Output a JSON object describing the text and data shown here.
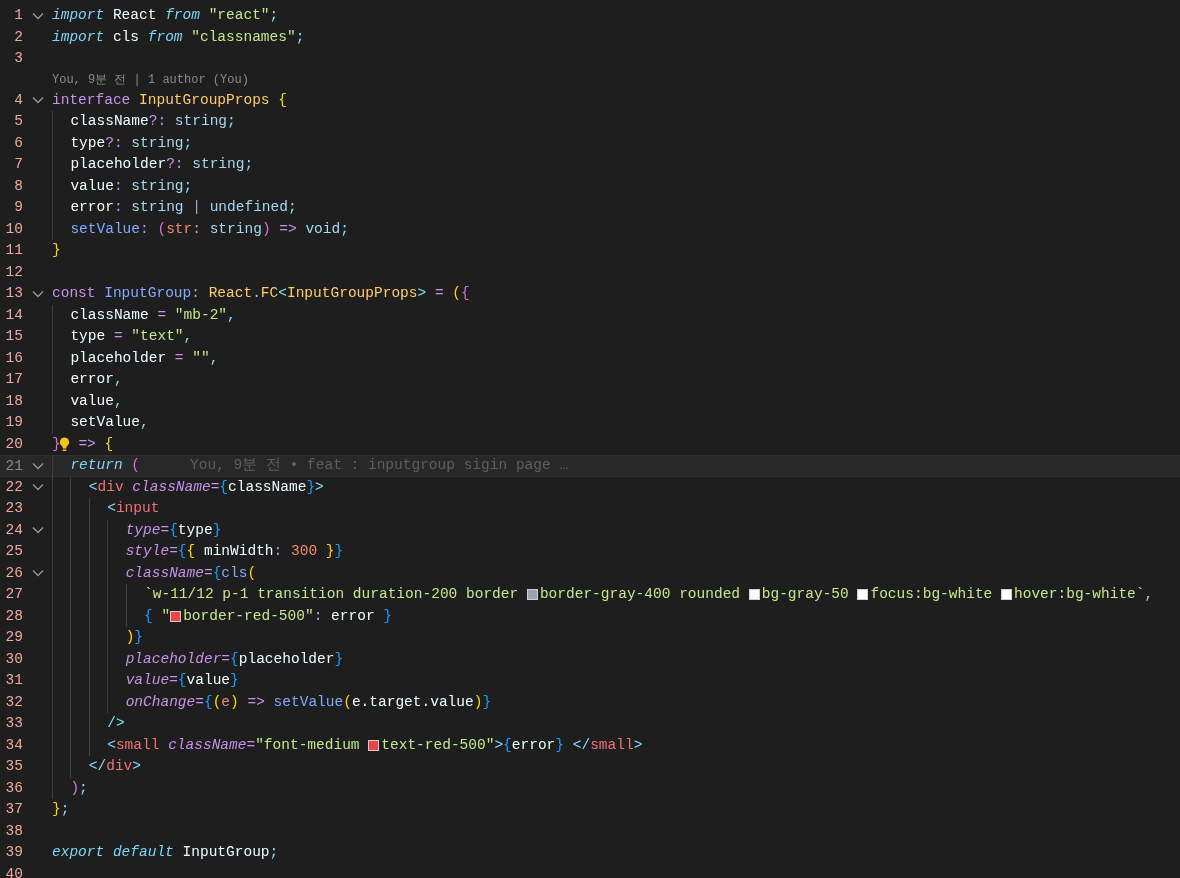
{
  "editor": {
    "lines": [
      {
        "kind": "code",
        "number": "1",
        "fold": true,
        "tokens": [
          {
            "text": "import",
            "kind": "kw"
          },
          {
            "text": " React ",
            "kind": "plain"
          },
          {
            "text": "from",
            "kind": "kw"
          },
          {
            "text": " \"react\"",
            "kind": "string"
          },
          {
            "text": ";",
            "kind": "punct"
          }
        ]
      },
      {
        "kind": "code",
        "number": "2",
        "fold": false,
        "tokens": [
          {
            "text": "import",
            "kind": "kw"
          },
          {
            "text": " cls ",
            "kind": "plain"
          },
          {
            "text": "from",
            "kind": "kw"
          },
          {
            "text": " \"classnames\"",
            "kind": "string"
          },
          {
            "text": ";",
            "kind": "punct"
          }
        ]
      },
      {
        "kind": "code",
        "number": "3",
        "fold": false
      },
      {
        "kind": "codelens",
        "text": "You, 9분 전 | 1 author (You)"
      },
      {
        "kind": "code",
        "number": "4",
        "fold": true,
        "tokens": [
          {
            "text": "interface",
            "kind": "storage"
          },
          {
            "text": " InputGroupProps",
            "kind": "typename"
          },
          {
            "text": " {",
            "kind": "b1"
          }
        ]
      },
      {
        "kind": "code",
        "number": "5",
        "fold": false,
        "tokens": [
          {
            "text": "  className",
            "kind": "plain"
          },
          {
            "text": "?:",
            "kind": "op"
          },
          {
            "text": " string",
            "kind": "builtin"
          },
          {
            "text": ";",
            "kind": "punct"
          }
        ]
      },
      {
        "kind": "code",
        "number": "6",
        "fold": false,
        "tokens": [
          {
            "text": "  type",
            "kind": "plain"
          },
          {
            "text": "?:",
            "kind": "op"
          },
          {
            "text": " string",
            "kind": "builtin"
          },
          {
            "text": ";",
            "kind": "punct"
          }
        ]
      },
      {
        "kind": "code",
        "number": "7",
        "fold": false,
        "tokens": [
          {
            "text": "  placeholder",
            "kind": "plain"
          },
          {
            "text": "?:",
            "kind": "op"
          },
          {
            "text": " string",
            "kind": "builtin"
          },
          {
            "text": ";",
            "kind": "punct"
          }
        ]
      },
      {
        "kind": "code",
        "number": "8",
        "fold": false,
        "tokens": [
          {
            "text": "  value",
            "kind": "plain"
          },
          {
            "text": ":",
            "kind": "op"
          },
          {
            "text": " string",
            "kind": "builtin"
          },
          {
            "text": ";",
            "kind": "punct"
          }
        ]
      },
      {
        "kind": "code",
        "number": "9",
        "fold": false,
        "tokens": [
          {
            "text": "  error",
            "kind": "plain"
          },
          {
            "text": ":",
            "kind": "op"
          },
          {
            "text": " string ",
            "kind": "builtin"
          },
          {
            "text": "|",
            "kind": "op"
          },
          {
            "text": " undefined",
            "kind": "builtin"
          },
          {
            "text": ";",
            "kind": "punct"
          }
        ]
      },
      {
        "kind": "code",
        "number": "10",
        "fold": false,
        "tokens": [
          {
            "text": "  setValue",
            "kind": "func"
          },
          {
            "text": ":",
            "kind": "op"
          },
          {
            "text": " (",
            "kind": "b2"
          },
          {
            "text": "str",
            "kind": "param"
          },
          {
            "text": ":",
            "kind": "op"
          },
          {
            "text": " string",
            "kind": "builtin"
          },
          {
            "text": ")",
            "kind": "b2"
          },
          {
            "text": " =>",
            "kind": "storage"
          },
          {
            "text": " void",
            "kind": "builtin"
          },
          {
            "text": ";",
            "kind": "punct"
          }
        ]
      },
      {
        "kind": "code",
        "number": "11",
        "fold": false,
        "tokens": [
          {
            "text": "}",
            "kind": "b1"
          }
        ]
      },
      {
        "kind": "code",
        "number": "12",
        "fold": false
      },
      {
        "kind": "code",
        "number": "13",
        "fold": true,
        "tokens": [
          {
            "text": "const",
            "kind": "storage"
          },
          {
            "text": " InputGroup",
            "kind": "func"
          },
          {
            "text": ":",
            "kind": "op"
          },
          {
            "text": " React",
            "kind": "typename"
          },
          {
            "text": ".",
            "kind": "punct"
          },
          {
            "text": "FC",
            "kind": "typename"
          },
          {
            "text": "<",
            "kind": "punct"
          },
          {
            "text": "InputGroupProps",
            "kind": "typename"
          },
          {
            "text": ">",
            "kind": "punct"
          },
          {
            "text": " = ",
            "kind": "op"
          },
          {
            "text": "(",
            "kind": "b1"
          },
          {
            "text": "{",
            "kind": "b2"
          }
        ]
      },
      {
        "kind": "code",
        "number": "14",
        "fold": false,
        "tokens": [
          {
            "text": "  className",
            "kind": "plain"
          },
          {
            "text": " = ",
            "kind": "op"
          },
          {
            "text": "\"mb-2\"",
            "kind": "string"
          },
          {
            "text": ",",
            "kind": "punct"
          }
        ]
      },
      {
        "kind": "code",
        "number": "15",
        "fold": false,
        "tokens": [
          {
            "text": "  type",
            "kind": "plain"
          },
          {
            "text": " = ",
            "kind": "op"
          },
          {
            "text": "\"text\"",
            "kind": "string"
          },
          {
            "text": ",",
            "kind": "punct"
          }
        ]
      },
      {
        "kind": "code",
        "number": "16",
        "fold": false,
        "tokens": [
          {
            "text": "  placeholder",
            "kind": "plain"
          },
          {
            "text": " = ",
            "kind": "op"
          },
          {
            "text": "\"\"",
            "kind": "string"
          },
          {
            "text": ",",
            "kind": "punct"
          }
        ]
      },
      {
        "kind": "code",
        "number": "17",
        "fold": false,
        "tokens": [
          {
            "text": "  error",
            "kind": "plain"
          },
          {
            "text": ",",
            "kind": "punct"
          }
        ]
      },
      {
        "kind": "code",
        "number": "18",
        "fold": false,
        "tokens": [
          {
            "text": "  value",
            "kind": "plain"
          },
          {
            "text": ",",
            "kind": "punct"
          }
        ]
      },
      {
        "kind": "code",
        "number": "19",
        "fold": false,
        "tokens": [
          {
            "text": "  setValue",
            "kind": "plain"
          },
          {
            "text": ",",
            "kind": "punct"
          }
        ]
      },
      {
        "kind": "code",
        "number": "20",
        "fold": false,
        "tokens": [
          {
            "text": "}",
            "kind": "b2"
          },
          {
            "kind": "lightbulb"
          },
          {
            "text": " =>",
            "kind": "storage"
          },
          {
            "text": " {",
            "kind": "b1"
          }
        ]
      },
      {
        "kind": "code",
        "number": "21",
        "fold": true,
        "selected": true,
        "blame": "You, 9분 전 • feat : inputgroup sigin page …",
        "tokens": [
          {
            "text": "  return",
            "kind": "kw"
          },
          {
            "text": " (",
            "kind": "b2"
          }
        ]
      },
      {
        "kind": "code",
        "number": "22",
        "fold": true,
        "tokens": [
          {
            "text": "    <",
            "kind": "punct"
          },
          {
            "text": "div",
            "kind": "tag"
          },
          {
            "text": " className",
            "kind": "attr"
          },
          {
            "text": "=",
            "kind": "op"
          },
          {
            "text": "{",
            "kind": "b3"
          },
          {
            "text": "className",
            "kind": "plain"
          },
          {
            "text": "}",
            "kind": "b3"
          },
          {
            "text": ">",
            "kind": "punct"
          }
        ]
      },
      {
        "kind": "code",
        "number": "23",
        "fold": false,
        "tokens": [
          {
            "text": "      <",
            "kind": "punct"
          },
          {
            "text": "input",
            "kind": "tag"
          }
        ]
      },
      {
        "kind": "code",
        "number": "24",
        "fold": true,
        "tokens": [
          {
            "text": "        type",
            "kind": "attr"
          },
          {
            "text": "=",
            "kind": "op"
          },
          {
            "text": "{",
            "kind": "b3"
          },
          {
            "text": "type",
            "kind": "plain"
          },
          {
            "text": "}",
            "kind": "b3"
          }
        ]
      },
      {
        "kind": "code",
        "number": "25",
        "fold": false,
        "tokens": [
          {
            "text": "        style",
            "kind": "attr"
          },
          {
            "text": "=",
            "kind": "op"
          },
          {
            "text": "{",
            "kind": "b3"
          },
          {
            "text": "{",
            "kind": "b1"
          },
          {
            "text": " minWidth",
            "kind": "plain"
          },
          {
            "text": ":",
            "kind": "op"
          },
          {
            "text": " 300",
            "kind": "number"
          },
          {
            "text": " }",
            "kind": "b1"
          },
          {
            "text": "}",
            "kind": "b3"
          }
        ]
      },
      {
        "kind": "code",
        "number": "26",
        "fold": true,
        "tokens": [
          {
            "text": "        className",
            "kind": "attr"
          },
          {
            "text": "=",
            "kind": "op"
          },
          {
            "text": "{",
            "kind": "b3"
          },
          {
            "text": "cls",
            "kind": "func"
          },
          {
            "text": "(",
            "kind": "b1"
          }
        ]
      },
      {
        "kind": "code",
        "number": "27",
        "fold": false,
        "tokens": [
          {
            "text": "          `w-11/12 p-1 transition duration-200 border ",
            "kind": "string"
          },
          {
            "kind": "swatch",
            "color": "#9ca3af"
          },
          {
            "text": "border-gray-400 rounded ",
            "kind": "string"
          },
          {
            "kind": "swatch",
            "color": "#f9fafb"
          },
          {
            "text": "bg-gray-50 ",
            "kind": "string"
          },
          {
            "kind": "swatch",
            "color": "#ffffff"
          },
          {
            "text": "focus:bg-white ",
            "kind": "string"
          },
          {
            "kind": "swatch",
            "color": "#ffffff"
          },
          {
            "text": "hover:bg-white`",
            "kind": "string"
          },
          {
            "text": ",",
            "kind": "punct"
          }
        ]
      },
      {
        "kind": "code",
        "number": "28",
        "fold": false,
        "tokens": [
          {
            "text": "          {",
            "kind": "b3"
          },
          {
            "text": " \"",
            "kind": "string"
          },
          {
            "kind": "swatch",
            "color": "#ef4444"
          },
          {
            "text": "border-red-500\"",
            "kind": "string"
          },
          {
            "text": ":",
            "kind": "op"
          },
          {
            "text": " error ",
            "kind": "plain"
          },
          {
            "text": "}",
            "kind": "b3"
          }
        ]
      },
      {
        "kind": "code",
        "number": "29",
        "fold": false,
        "tokens": [
          {
            "text": "        )",
            "kind": "b1"
          },
          {
            "text": "}",
            "kind": "b3"
          }
        ]
      },
      {
        "kind": "code",
        "number": "30",
        "fold": false,
        "tokens": [
          {
            "text": "        placeholder",
            "kind": "attr"
          },
          {
            "text": "=",
            "kind": "op"
          },
          {
            "text": "{",
            "kind": "b3"
          },
          {
            "text": "placeholder",
            "kind": "plain"
          },
          {
            "text": "}",
            "kind": "b3"
          }
        ]
      },
      {
        "kind": "code",
        "number": "31",
        "fold": false,
        "tokens": [
          {
            "text": "        value",
            "kind": "attr"
          },
          {
            "text": "=",
            "kind": "op"
          },
          {
            "text": "{",
            "kind": "b3"
          },
          {
            "text": "value",
            "kind": "plain"
          },
          {
            "text": "}",
            "kind": "b3"
          }
        ]
      },
      {
        "kind": "code",
        "number": "32",
        "fold": false,
        "tokens": [
          {
            "text": "        onChange",
            "kind": "attr"
          },
          {
            "text": "=",
            "kind": "op"
          },
          {
            "text": "{",
            "kind": "b3"
          },
          {
            "text": "(",
            "kind": "b1"
          },
          {
            "text": "e",
            "kind": "param"
          },
          {
            "text": ")",
            "kind": "b1"
          },
          {
            "text": " =>",
            "kind": "storage"
          },
          {
            "text": " setValue",
            "kind": "func"
          },
          {
            "text": "(",
            "kind": "b1"
          },
          {
            "text": "e.target.value",
            "kind": "plain"
          },
          {
            "text": ")",
            "kind": "b1"
          },
          {
            "text": "}",
            "kind": "b3"
          }
        ]
      },
      {
        "kind": "code",
        "number": "33",
        "fold": false,
        "tokens": [
          {
            "text": "      />",
            "kind": "punct"
          }
        ]
      },
      {
        "kind": "code",
        "number": "34",
        "fold": false,
        "tokens": [
          {
            "text": "      <",
            "kind": "punct"
          },
          {
            "text": "small",
            "kind": "tag"
          },
          {
            "text": " className",
            "kind": "attr"
          },
          {
            "text": "=",
            "kind": "op"
          },
          {
            "text": "\"font-medium ",
            "kind": "string"
          },
          {
            "kind": "swatch",
            "color": "#ef4444"
          },
          {
            "text": "text-red-500\"",
            "kind": "string"
          },
          {
            "text": ">",
            "kind": "punct"
          },
          {
            "text": "{",
            "kind": "b3"
          },
          {
            "text": "error",
            "kind": "plain"
          },
          {
            "text": "}",
            "kind": "b3"
          },
          {
            "text": " </",
            "kind": "punct"
          },
          {
            "text": "small",
            "kind": "tag"
          },
          {
            "text": ">",
            "kind": "punct"
          }
        ]
      },
      {
        "kind": "code",
        "number": "35",
        "fold": false,
        "tokens": [
          {
            "text": "    </",
            "kind": "punct"
          },
          {
            "text": "div",
            "kind": "tag"
          },
          {
            "text": ">",
            "kind": "punct"
          }
        ]
      },
      {
        "kind": "code",
        "number": "36",
        "fold": false,
        "tokens": [
          {
            "text": "  )",
            "kind": "b2"
          },
          {
            "text": ";",
            "kind": "punct"
          }
        ]
      },
      {
        "kind": "code",
        "number": "37",
        "fold": false,
        "tokens": [
          {
            "text": "}",
            "kind": "b1"
          },
          {
            "text": ";",
            "kind": "punct"
          }
        ]
      },
      {
        "kind": "code",
        "number": "38",
        "fold": false
      },
      {
        "kind": "code",
        "number": "39",
        "fold": false,
        "tokens": [
          {
            "text": "export default",
            "kind": "kw"
          },
          {
            "text": " InputGroup",
            "kind": "plain"
          },
          {
            "text": ";",
            "kind": "punct"
          }
        ]
      },
      {
        "kind": "code",
        "number": "40",
        "fold": false
      }
    ]
  }
}
